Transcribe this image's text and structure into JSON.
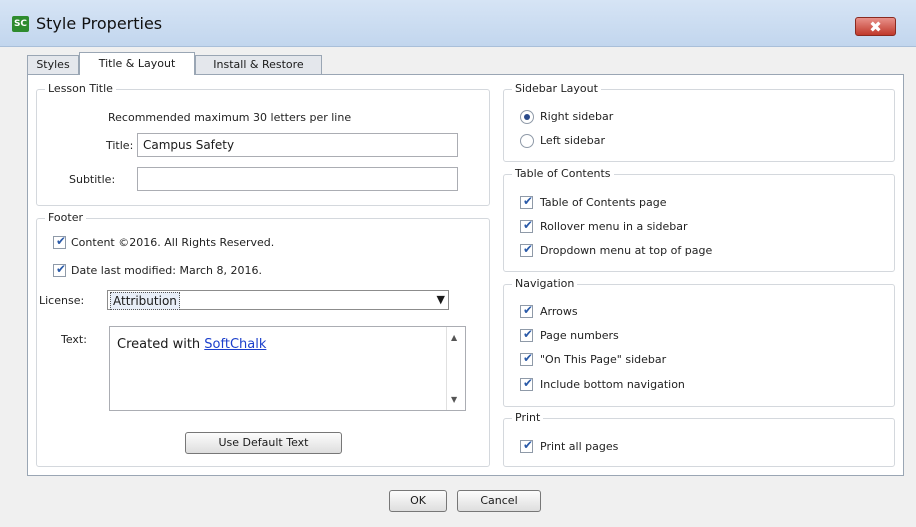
{
  "window": {
    "title": "Style Properties",
    "app_icon": "SC",
    "close_glyph": "✖"
  },
  "tabs": [
    {
      "label": "Styles",
      "active": false
    },
    {
      "label": "Title & Layout",
      "active": true
    },
    {
      "label": "Install & Restore",
      "active": false
    }
  ],
  "lesson_title": {
    "legend": "Lesson Title",
    "hint": "Recommended maximum 30 letters per line",
    "title_label": "Title:",
    "title_value": "Campus Safety",
    "subtitle_label": "Subtitle:",
    "subtitle_value": ""
  },
  "footer": {
    "legend": "Footer",
    "content_check_label": "Content ©2016. All Rights Reserved.",
    "content_checked": true,
    "date_check_label": "Date last modified: March 8, 2016.",
    "date_checked": true,
    "license_label": "License:",
    "license_value": "Attribution",
    "text_label": "Text:",
    "text_prefix": "Created with ",
    "text_link": "SoftChalk",
    "default_button": "Use Default Text"
  },
  "sidebar_layout": {
    "legend": "Sidebar Layout",
    "right_label": "Right sidebar",
    "left_label": "Left sidebar",
    "selected": "right"
  },
  "toc": {
    "legend": "Table of Contents",
    "items": [
      {
        "label": "Table of Contents page",
        "checked": true
      },
      {
        "label": "Rollover menu in a sidebar",
        "checked": true
      },
      {
        "label": "Dropdown menu at top of page",
        "checked": true
      }
    ]
  },
  "navigation": {
    "legend": "Navigation",
    "items": [
      {
        "label": "Arrows",
        "checked": true
      },
      {
        "label": "Page numbers",
        "checked": true
      },
      {
        "label": "\"On This Page\" sidebar",
        "checked": true
      },
      {
        "label": "Include bottom navigation",
        "checked": true
      }
    ]
  },
  "print": {
    "legend": "Print",
    "items": [
      {
        "label": "Print all pages",
        "checked": true
      }
    ]
  },
  "dialog_buttons": {
    "ok": "OK",
    "cancel": "Cancel"
  },
  "glyphs": {
    "tick": "✔",
    "dropdown": "▼",
    "scroll_up": "▲",
    "scroll_down": "▼"
  }
}
